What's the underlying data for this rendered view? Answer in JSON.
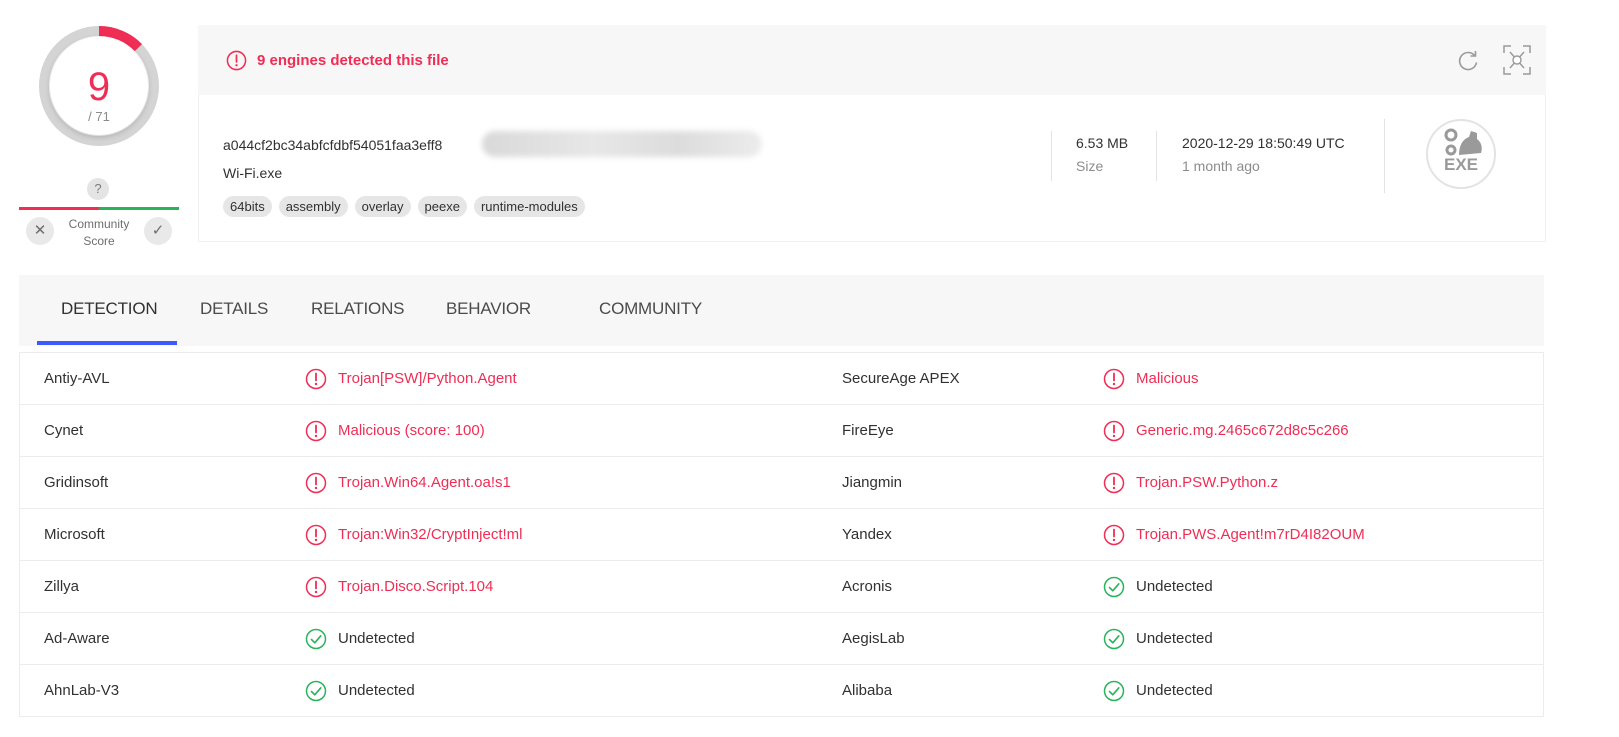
{
  "score": {
    "detections": "9",
    "total": "/ 71",
    "fraction": 0.127
  },
  "community": {
    "question": "?",
    "label": "Community Score",
    "down_icon": "x-icon",
    "up_icon": "check-icon"
  },
  "banner": {
    "text": "9 engines detected this file",
    "alert_icon": "alert-circle-icon",
    "reanalyze_icon": "reanalyze-icon",
    "similar_icon": "similar-files-icon"
  },
  "file": {
    "hash": "a044cf2bc34abfcfdbf54051faa3eff8",
    "name": "Wi-Fi.exe",
    "tags": [
      "64bits",
      "assembly",
      "overlay",
      "peexe",
      "runtime-modules"
    ],
    "size_value": "6.53 MB",
    "size_label": "Size",
    "date_value": "2020-12-29 18:50:49 UTC",
    "date_relative": "1 month ago",
    "type_badge": "EXE"
  },
  "tabs": [
    {
      "label": "DETECTION",
      "active": true
    },
    {
      "label": "DETAILS",
      "active": false
    },
    {
      "label": "RELATIONS",
      "active": false
    },
    {
      "label": "BEHAVIOR",
      "active": false
    },
    {
      "label": "COMMUNITY",
      "active": false
    }
  ],
  "colors": {
    "malicious": "#f02d55",
    "clean": "#29b35b",
    "tab_accent": "#3d5afe"
  },
  "detections": [
    {
      "left": {
        "engine": "Antiy-AVL",
        "result": "Trojan[PSW]/Python.Agent",
        "status": "malicious"
      },
      "right": {
        "engine": "SecureAge APEX",
        "result": "Malicious",
        "status": "malicious"
      }
    },
    {
      "left": {
        "engine": "Cynet",
        "result": "Malicious (score: 100)",
        "status": "malicious"
      },
      "right": {
        "engine": "FireEye",
        "result": "Generic.mg.2465c672d8c5c266",
        "status": "malicious"
      }
    },
    {
      "left": {
        "engine": "Gridinsoft",
        "result": "Trojan.Win64.Agent.oa!s1",
        "status": "malicious"
      },
      "right": {
        "engine": "Jiangmin",
        "result": "Trojan.PSW.Python.z",
        "status": "malicious"
      }
    },
    {
      "left": {
        "engine": "Microsoft",
        "result": "Trojan:Win32/CryptInject!ml",
        "status": "malicious"
      },
      "right": {
        "engine": "Yandex",
        "result": "Trojan.PWS.Agent!m7rD4I82OUM",
        "status": "malicious"
      }
    },
    {
      "left": {
        "engine": "Zillya",
        "result": "Trojan.Disco.Script.104",
        "status": "malicious"
      },
      "right": {
        "engine": "Acronis",
        "result": "Undetected",
        "status": "clean"
      }
    },
    {
      "left": {
        "engine": "Ad-Aware",
        "result": "Undetected",
        "status": "clean"
      },
      "right": {
        "engine": "AegisLab",
        "result": "Undetected",
        "status": "clean"
      }
    },
    {
      "left": {
        "engine": "AhnLab-V3",
        "result": "Undetected",
        "status": "clean"
      },
      "right": {
        "engine": "Alibaba",
        "result": "Undetected",
        "status": "clean"
      }
    }
  ]
}
